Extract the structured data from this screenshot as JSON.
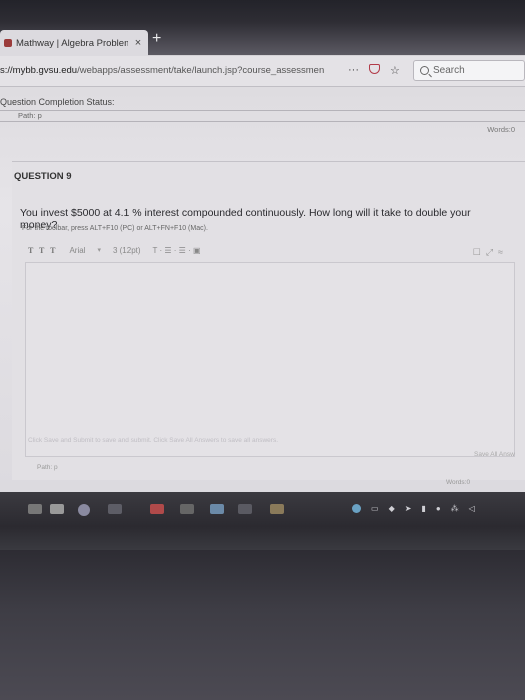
{
  "browser": {
    "tab_title": "Mathway | Algebra Problem S",
    "tab_close": "×",
    "new_tab": "+",
    "url_host": "s://mybb.gvsu.edu",
    "url_path": "/webapps/assessment/take/launch.jsp?course_assessmen",
    "nav_icons": [
      "···"
    ],
    "search_placeholder": "Search"
  },
  "page": {
    "status_label": "Question Completion Status:",
    "path_label": "Path: p",
    "words_label": "Words:0",
    "question_number": "QUESTION 9",
    "question_text": "You invest $5000 at 4.1 % interest compounded continuously.  How long will it take to double your money?",
    "toolbar_hint": "For the toolbar, press ALT+F10 (PC) or ALT+FN+F10 (Mac).",
    "toolbar": {
      "formats": "T T T",
      "font": "Arial",
      "size": "3 (12pt)",
      "arrow": "▾"
    },
    "editor_path": "Path: p",
    "editor_words": "Words:0",
    "footer_hint": "Click Save and Submit to save and submit. Click Save All Answers to save all answers.",
    "save_all": "Save All Answ"
  },
  "colors": {
    "accent": "#b23a48",
    "taskbar": "#2e2d33"
  }
}
